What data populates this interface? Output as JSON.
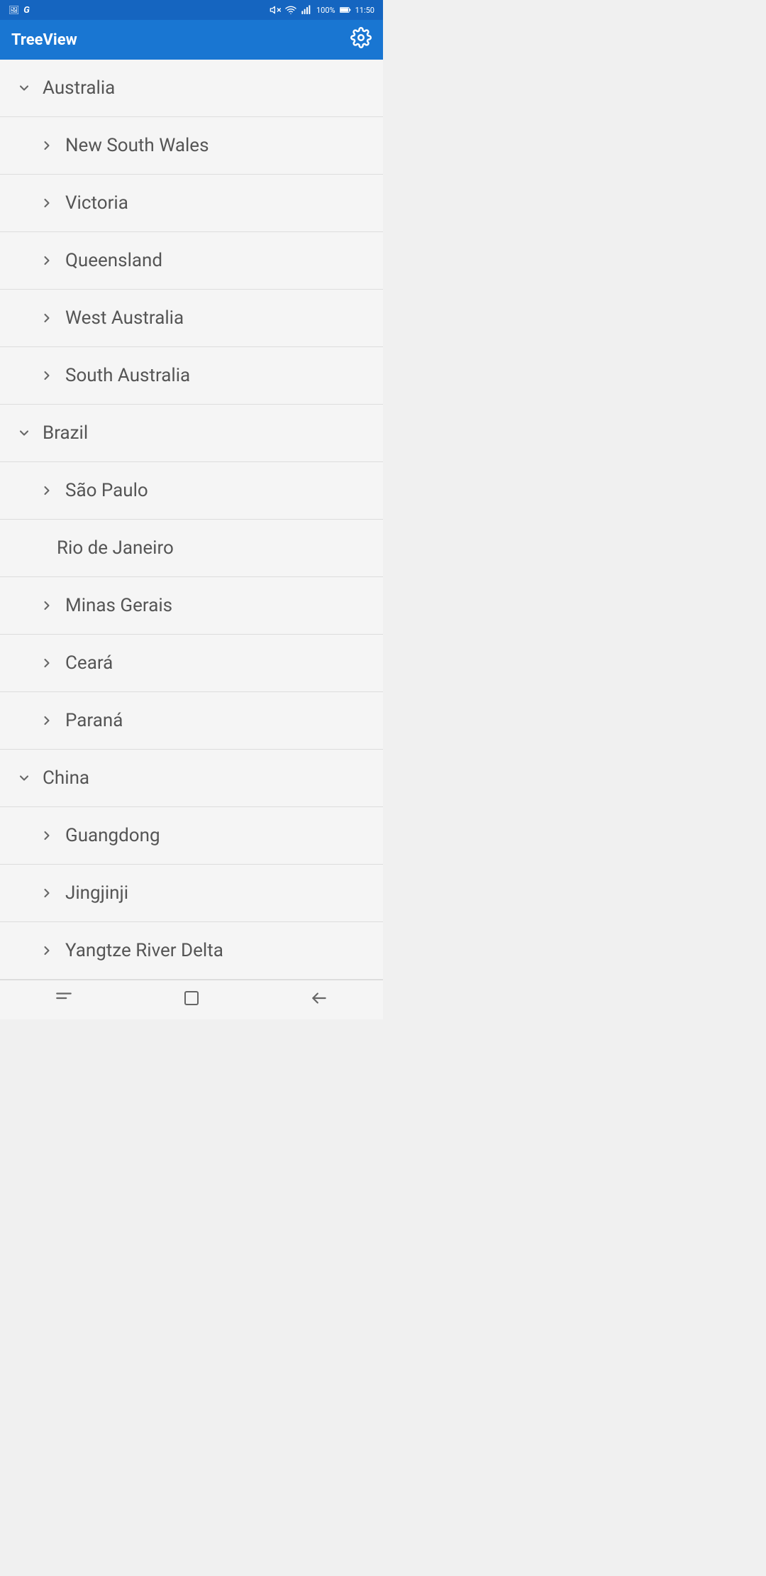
{
  "app": {
    "title": "TreeView"
  },
  "statusBar": {
    "time": "11:50",
    "battery": "100%"
  },
  "tree": [
    {
      "id": "australia",
      "label": "Australia",
      "expanded": true,
      "children": [
        {
          "id": "nsw",
          "label": "New South Wales",
          "expanded": false
        },
        {
          "id": "vic",
          "label": "Victoria",
          "expanded": false
        },
        {
          "id": "qld",
          "label": "Queensland",
          "expanded": false
        },
        {
          "id": "wa",
          "label": "West Australia",
          "expanded": false
        },
        {
          "id": "sa",
          "label": "South Australia",
          "expanded": false
        }
      ]
    },
    {
      "id": "brazil",
      "label": "Brazil",
      "expanded": true,
      "children": [
        {
          "id": "sp",
          "label": "São Paulo",
          "expanded": true,
          "children": [
            {
              "id": "rj",
              "label": "Rio de Janeiro",
              "leaf": true
            }
          ]
        },
        {
          "id": "mg",
          "label": "Minas Gerais",
          "expanded": false
        },
        {
          "id": "ce",
          "label": "Ceará",
          "expanded": false
        },
        {
          "id": "pr",
          "label": "Paraná",
          "expanded": false
        }
      ]
    },
    {
      "id": "china",
      "label": "China",
      "expanded": true,
      "children": [
        {
          "id": "gd",
          "label": "Guangdong",
          "expanded": false
        },
        {
          "id": "jjj",
          "label": "Jingjinji",
          "expanded": false
        },
        {
          "id": "yrd",
          "label": "Yangtze River Delta",
          "expanded": false
        }
      ]
    }
  ],
  "navbar": {
    "menu_icon": "≡",
    "square_icon": "□",
    "back_icon": "←"
  }
}
